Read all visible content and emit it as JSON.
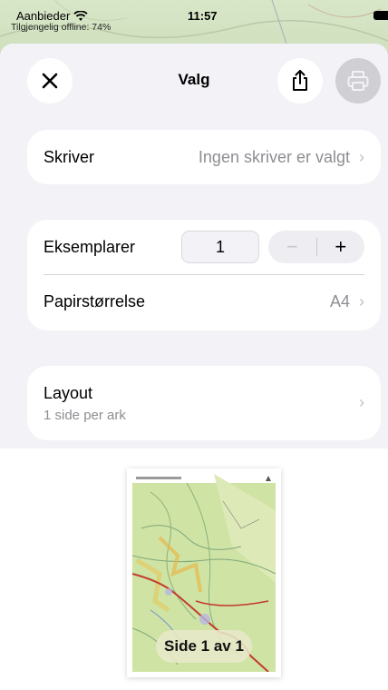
{
  "status_bar": {
    "carrier": "Aanbieder",
    "time": "11:57",
    "offline_note": "Tilgjengelig offline: 74%"
  },
  "header": {
    "title": "Valg",
    "icons": {
      "close": "close-icon",
      "share": "share-icon",
      "print": "printer-icon"
    }
  },
  "printer": {
    "label": "Skriver",
    "value": "Ingen skriver er valgt"
  },
  "copies": {
    "label": "Eksemplarer",
    "count": "1",
    "minus": "−",
    "plus": "+"
  },
  "paper": {
    "label": "Papirstørrelse",
    "value": "A4"
  },
  "layout": {
    "title": "Layout",
    "subtitle": "1 side per ark"
  },
  "preview": {
    "page_label": "Side 1 av 1"
  },
  "chevron": "›",
  "colors": {
    "sheet_bg": "#f2f2f7",
    "card_bg": "#ffffff",
    "secondary_text": "#8e8e93",
    "disabled_button": "#cfcfd4"
  }
}
